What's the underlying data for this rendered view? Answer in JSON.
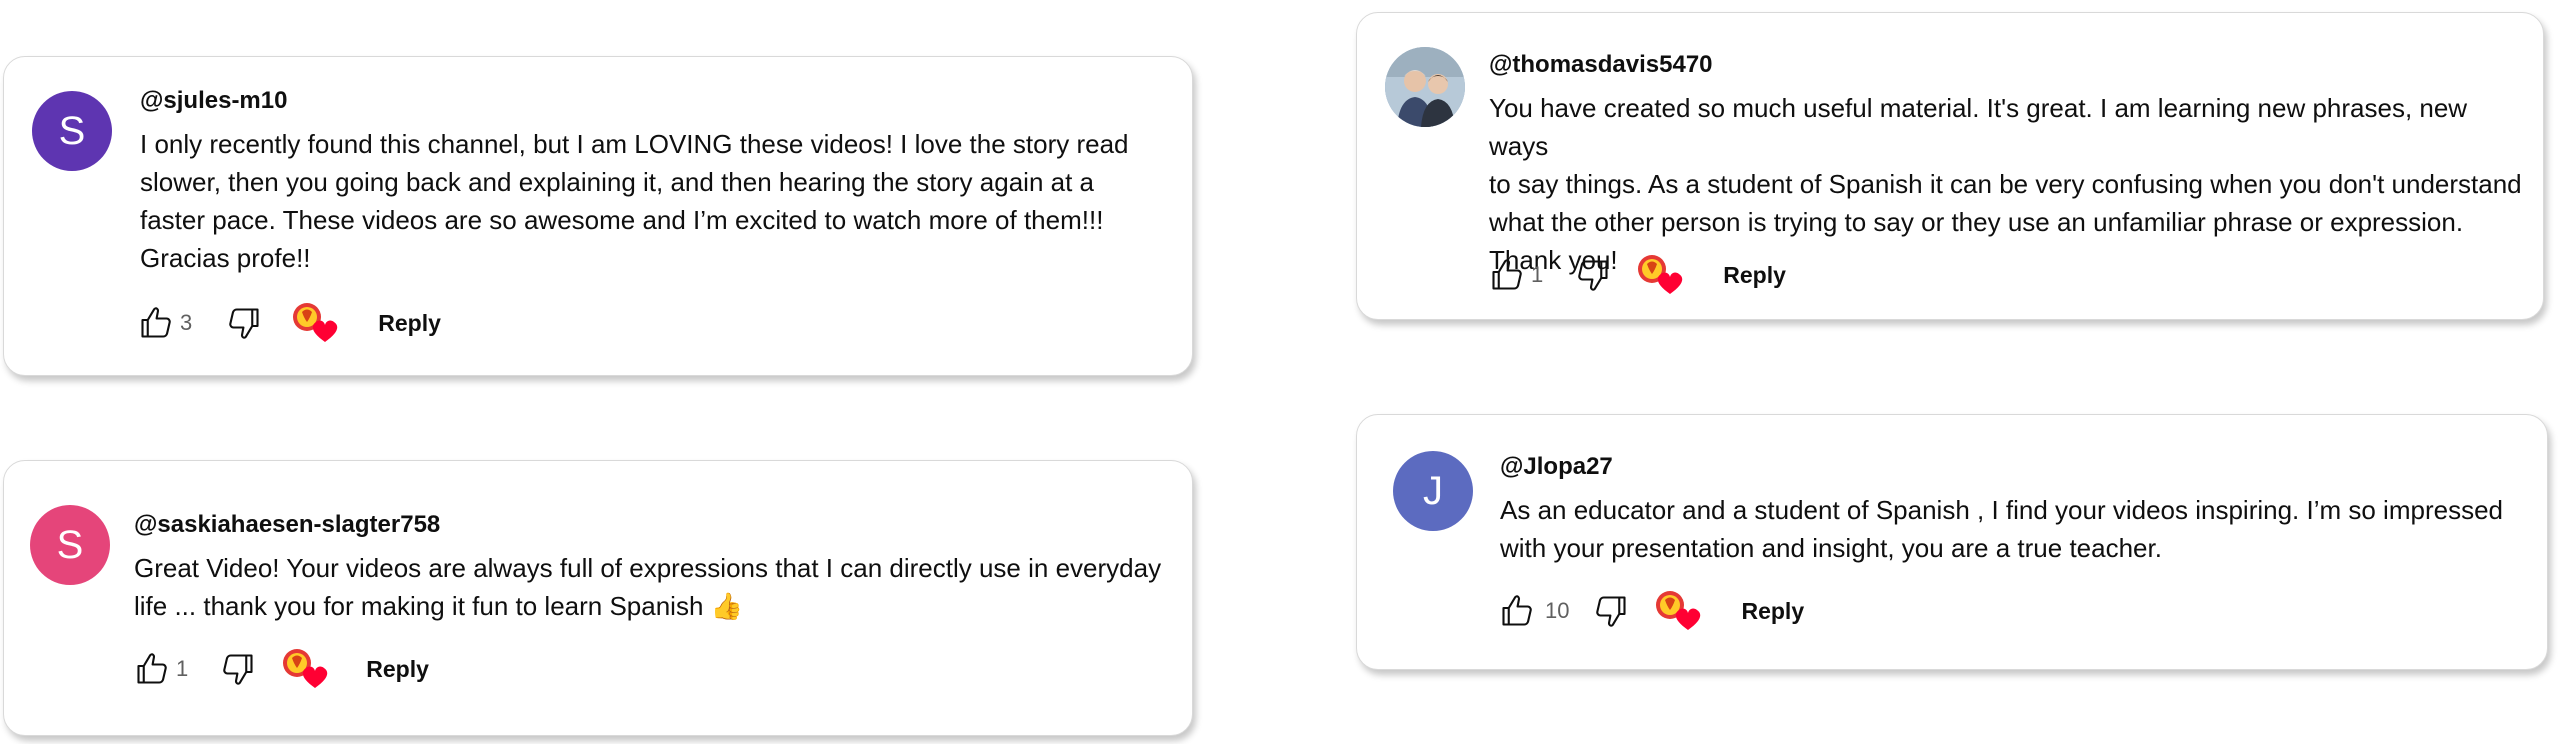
{
  "colors": {
    "avatar_sjules": "#5e35b1",
    "avatar_saskia": "#e5457a",
    "avatar_jlopa": "#5c6bc0",
    "like_icon": "#0f0f0f",
    "heart_red": "#ff0033"
  },
  "comments": [
    {
      "avatar_letter": "S",
      "handle": "@sjules-m10",
      "lines": [
        "I only recently found this channel, but I am LOVING these videos! I love the story read",
        "slower, then you going back and explaining it, and then hearing the story again at a",
        "faster pace. These videos are so awesome and I’m excited to watch more of them!!!",
        "Gracias profe!!"
      ],
      "likes": "3",
      "reply_label": "Reply"
    },
    {
      "avatar_letter": "S",
      "handle": "@saskiahaesen-slagter758",
      "lines": [
        "Great Video! Your videos are always full of expressions that I can directly use in everyday",
        "life ... thank you for making it fun to learn Spanish"
      ],
      "emoji": "👍",
      "likes": "1",
      "reply_label": "Reply"
    },
    {
      "avatar_letter": "",
      "avatar_icon": "photo-avatar",
      "handle": "@thomasdavis5470",
      "lines": [
        "You have created so much useful material. It's great. I am learning new phrases, new ways",
        "to say things. As a student of Spanish it can be very confusing when you don't understand",
        "what the other person is trying to say or they use an unfamiliar phrase or expression.",
        "Thank you!"
      ],
      "likes": "1",
      "reply_label": "Reply"
    },
    {
      "avatar_letter": "J",
      "handle": "@Jlopa27",
      "lines": [
        "As an educator and a student of Spanish , I find your videos inspiring. I’m so impressed",
        "with your presentation and insight, you are a true teacher."
      ],
      "likes": "10",
      "reply_label": "Reply"
    }
  ]
}
